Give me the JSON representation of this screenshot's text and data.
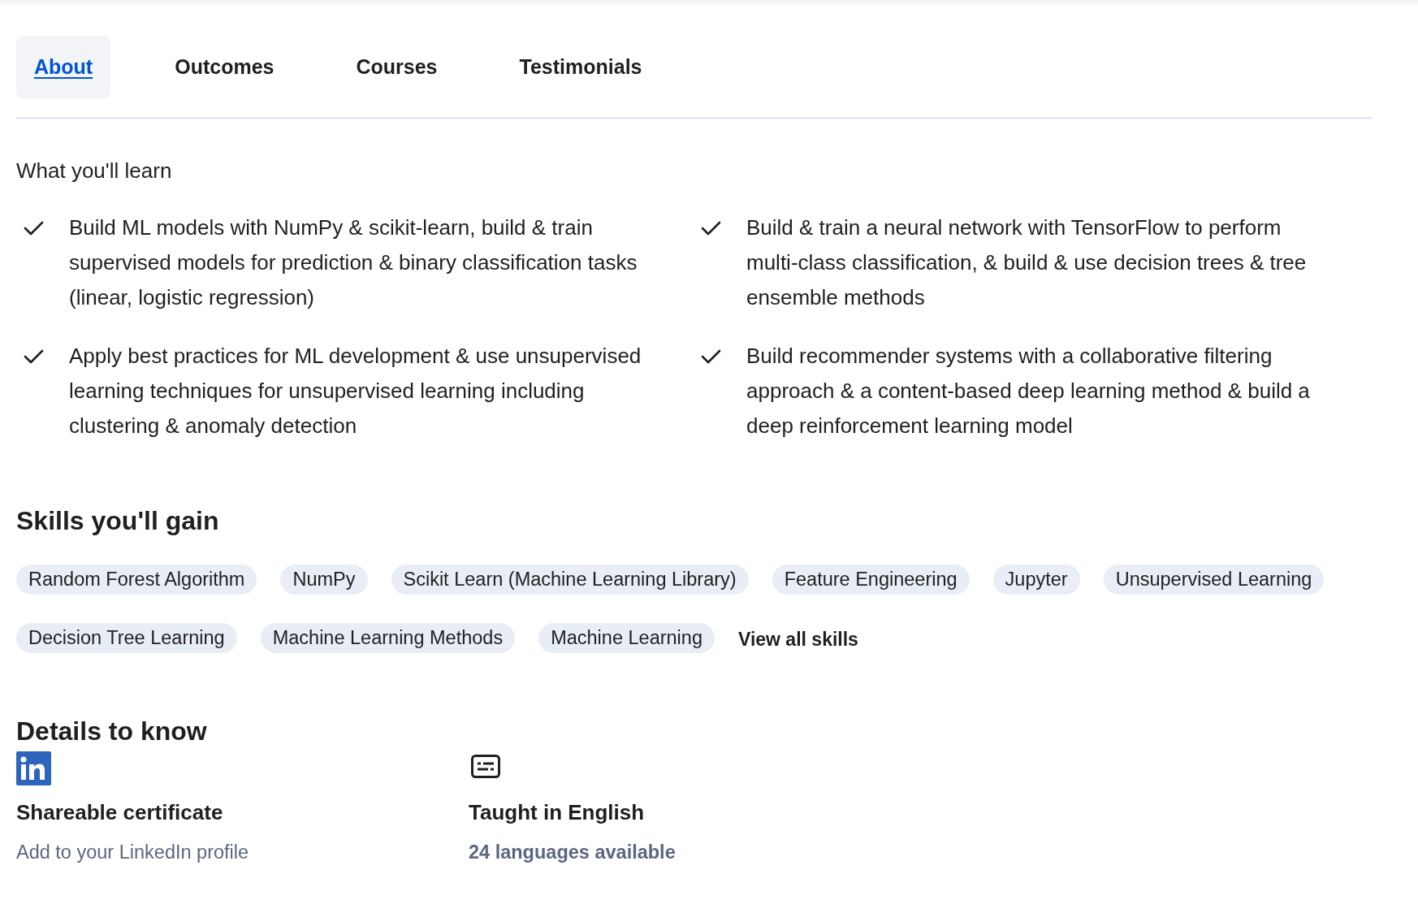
{
  "tabs": [
    {
      "label": "About",
      "selected": true
    },
    {
      "label": "Outcomes",
      "selected": false
    },
    {
      "label": "Courses",
      "selected": false
    },
    {
      "label": "Testimonials",
      "selected": false
    }
  ],
  "learn": {
    "title": "What you'll learn",
    "items": [
      "Build ML models with NumPy & scikit-learn, build & train supervised models for prediction & binary classification tasks (linear, logistic regression)",
      "Build & train a neural network with TensorFlow to perform multi-class classification, & build & use decision trees & tree ensemble methods",
      "Apply best practices for ML development & use unsupervised learning techniques for unsupervised learning including clustering & anomaly detection",
      "Build recommender systems with a collaborative filtering approach & a content-based deep learning method & build a deep reinforcement learning model"
    ]
  },
  "skills": {
    "title": "Skills you'll gain",
    "chips": [
      "Random Forest Algorithm",
      "NumPy",
      "Scikit Learn (Machine Learning Library)",
      "Feature Engineering",
      "Jupyter",
      "Unsupervised Learning",
      "Decision Tree Learning",
      "Machine Learning Methods",
      "Machine Learning"
    ],
    "link": "View all skills"
  },
  "details": {
    "title": "Details to know",
    "items": [
      {
        "kind": "linkedin",
        "title": "Shareable certificate",
        "subtitle": "Add to your LinkedIn profile"
      },
      {
        "kind": "captions",
        "title": "Taught in English",
        "subtitle": "24 languages available"
      }
    ]
  }
}
